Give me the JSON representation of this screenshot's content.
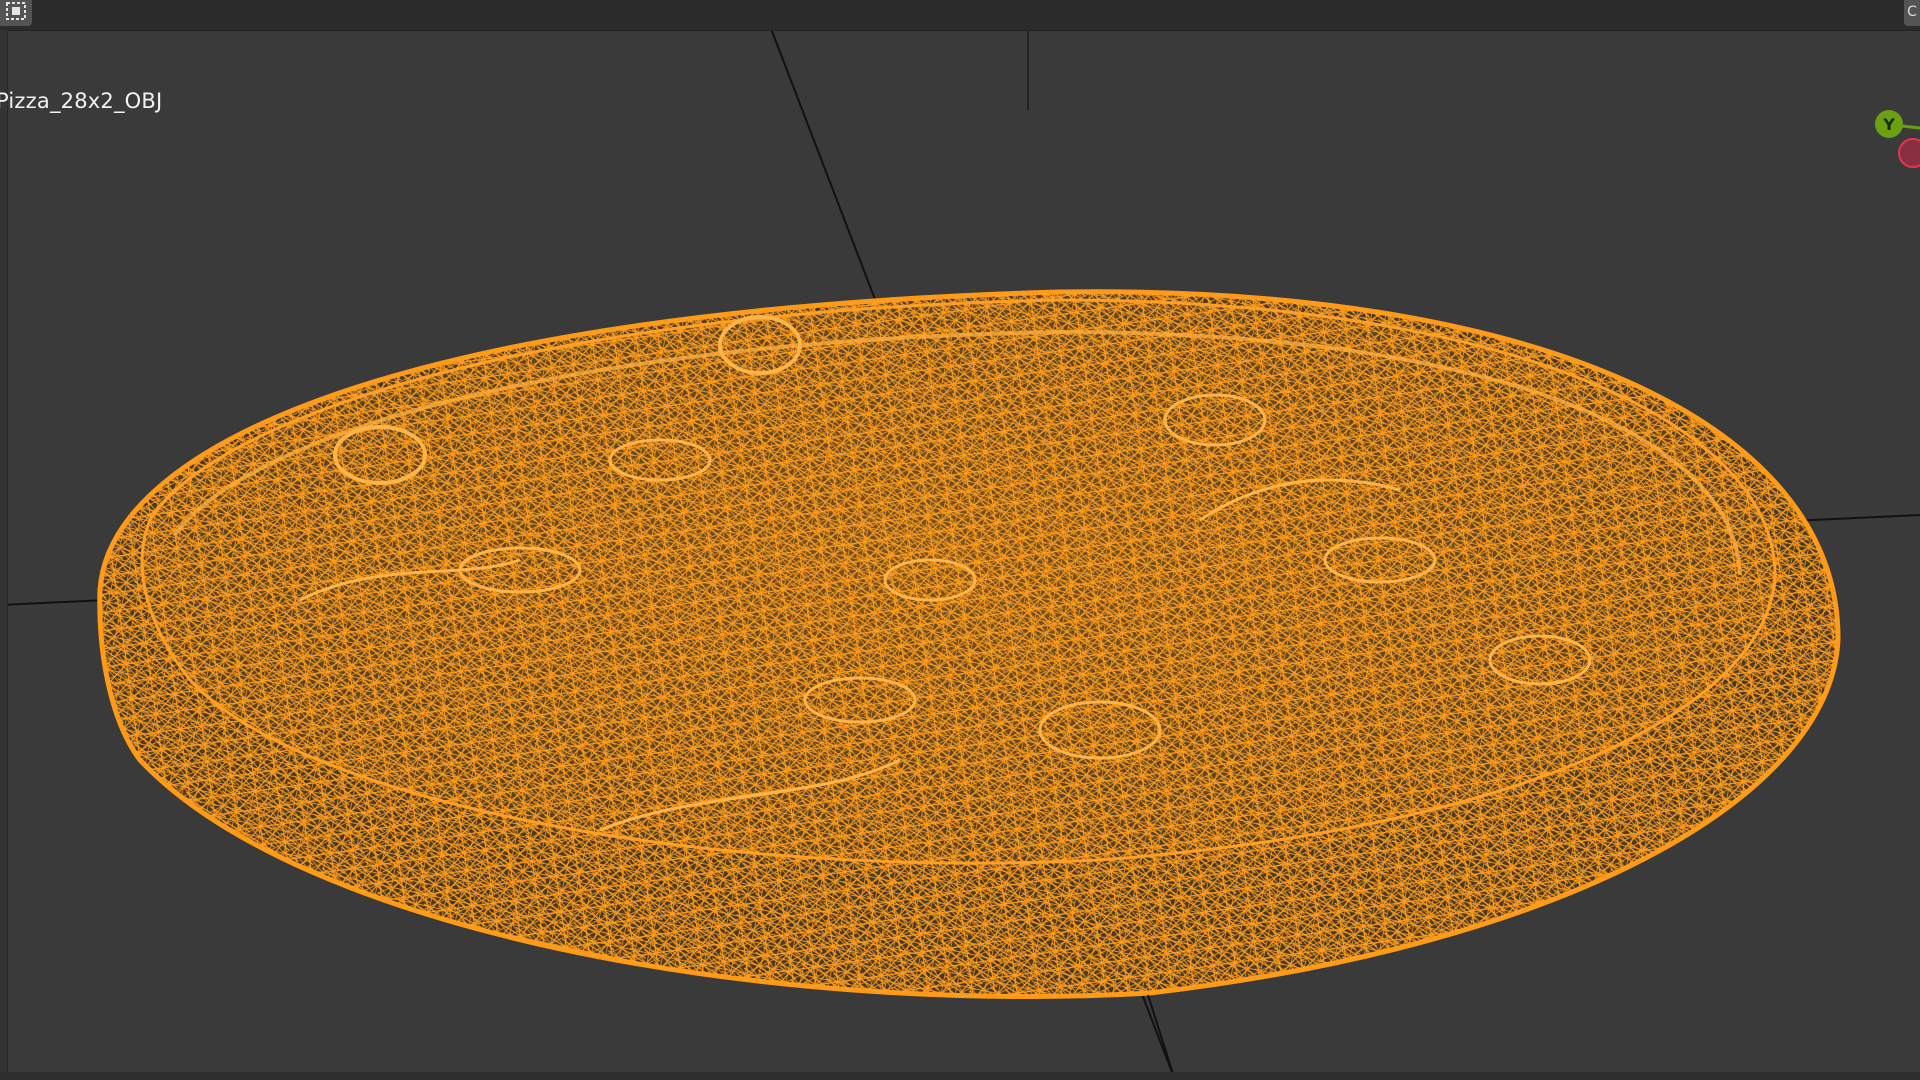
{
  "viewport": {
    "object_name": "Pizza_28x2_OBJ",
    "corner_right_label": "C",
    "shading_mode": "wireframe",
    "colors": {
      "background": "#3a3a3a",
      "wireframe": "#ff9a17",
      "grid_axis": "#111111"
    }
  },
  "navigation_gizmo": {
    "y_axis_label": "Y",
    "colors": {
      "y_axis": "#6aa012",
      "x_axis_negative": "#e0364e"
    }
  },
  "icons": {
    "select_mode": "select-box-icon"
  }
}
